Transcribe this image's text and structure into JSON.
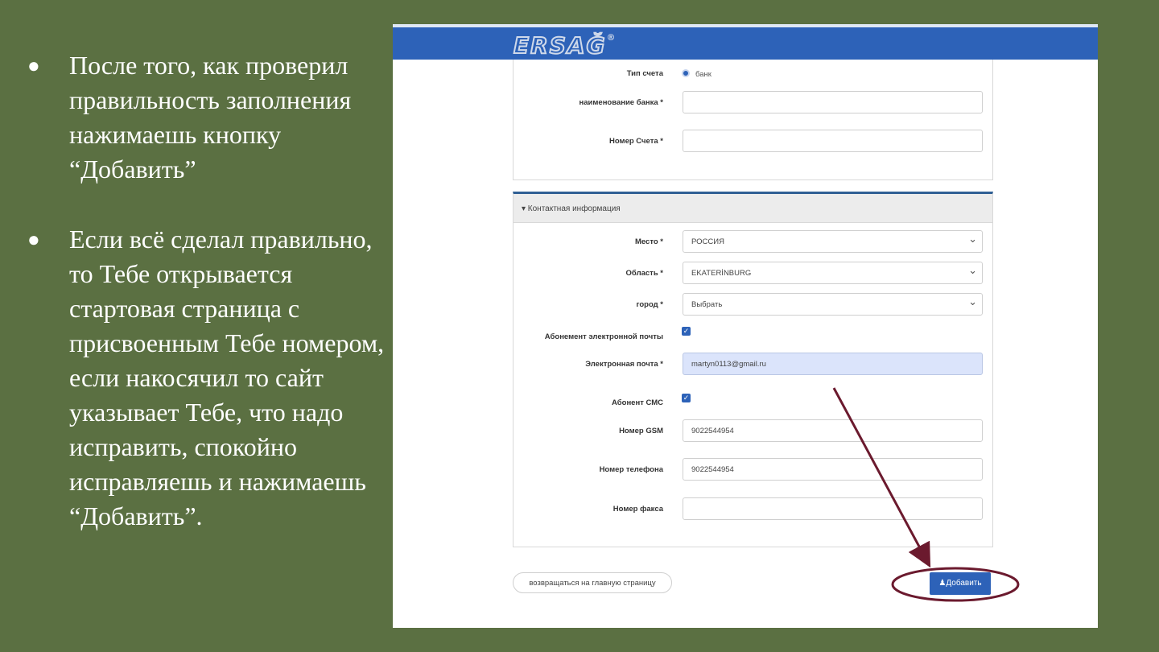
{
  "slide": {
    "bullets": [
      "После того, как проверил правильность заполнения нажимаешь кнопку “Добавить”",
      "Если всё сделал правильно, то Тебе открывается стартовая страница с присвоенным Тебе номером, если накосячил то сайт указывает Тебе, что надо исправить, спокойно исправляешь и нажимаешь “Добавить”."
    ]
  },
  "app": {
    "logo": "ERSAĞ",
    "logo_mark": "®"
  },
  "bank_section": {
    "account_type_label": "Тип счета",
    "account_type_value": "банк",
    "bank_name_label": "наименование банка *",
    "bank_name_value": "",
    "account_number_label": "Номер Счета *",
    "account_number_value": ""
  },
  "contact_section": {
    "header": "▾ Контактная информация",
    "place_label": "Место *",
    "place_value": "РОССИЯ",
    "region_label": "Область *",
    "region_value": "EKATERİNBURG",
    "city_label": "город *",
    "city_value": "Выбрать",
    "email_sub_label": "Абонемент электронной почты",
    "email_label": "Электронная почта *",
    "email_value": "martyn0113@gmail.ru",
    "sms_label": "Абонент СМС",
    "gsm_label": "Номер GSM",
    "gsm_value": "9022544954",
    "phone_label": "Номер телефона",
    "phone_value": "9022544954",
    "fax_label": "Номер факса",
    "fax_value": ""
  },
  "actions": {
    "back_label": "возвращаться на главную страницу",
    "add_label": "Добавить"
  },
  "colors": {
    "slide_bg": "#5b7042",
    "brand_blue": "#2d62b8",
    "annotation": "#6b1a2e"
  },
  "icons": {
    "checkbox": "check-icon",
    "user": "user-icon",
    "dropdown": "chevron-down-icon"
  }
}
